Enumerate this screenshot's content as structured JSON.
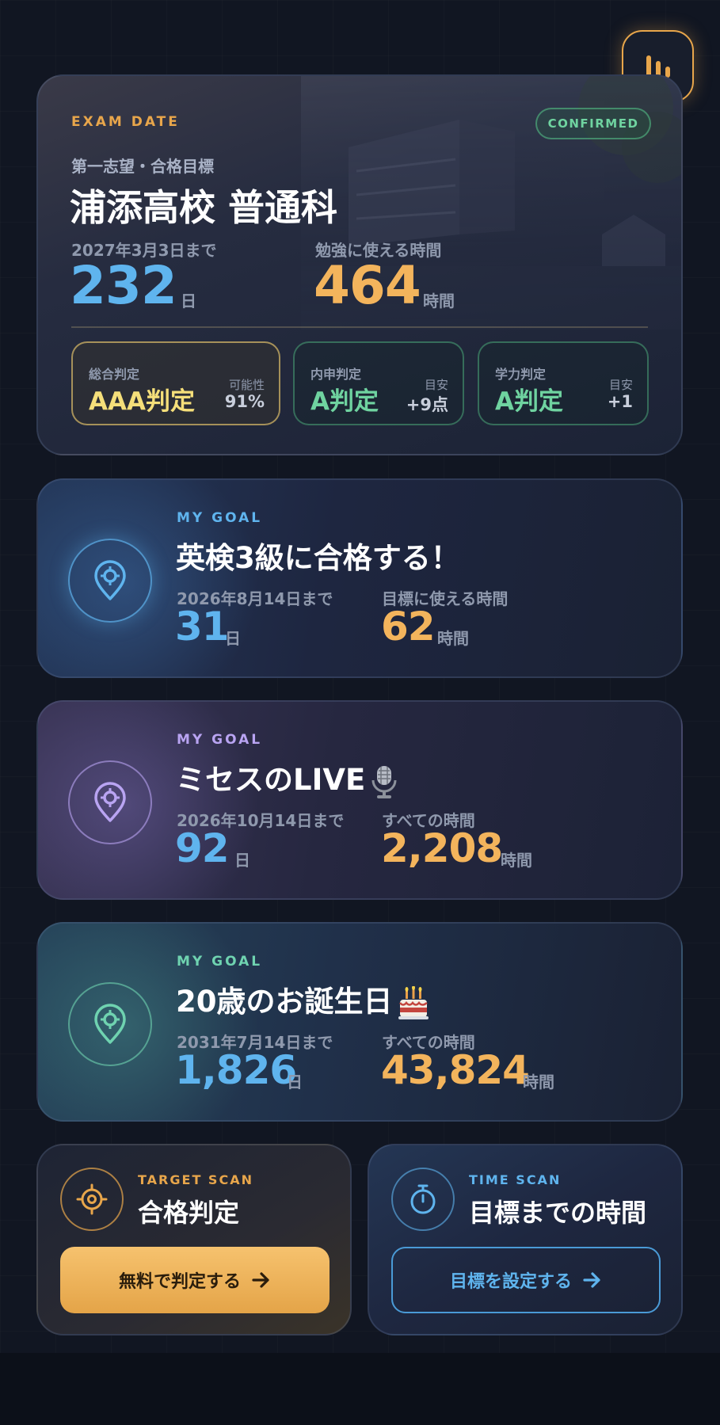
{
  "exam": {
    "label": "EXAM DATE",
    "status": "CONFIRMED",
    "sub_label": "第一志望・合格目標",
    "school": "浦添高校 普通科",
    "deadline_label": "2027年3月3日まで",
    "days": "232",
    "days_unit": "日",
    "hours_label": "勉強に使える時間",
    "hours": "464",
    "hours_unit": "時間",
    "judgements": [
      {
        "label": "総合判定",
        "value": "AAA判定",
        "sub_label": "可能性",
        "sub_value": "91%"
      },
      {
        "label": "内申判定",
        "value": "A判定",
        "sub_label": "目安",
        "sub_value": "+9点"
      },
      {
        "label": "学力判定",
        "value": "A判定",
        "sub_label": "目安",
        "sub_value": "+1"
      }
    ]
  },
  "goals": [
    {
      "caps": "MY GOAL",
      "title": "英検3級に合格する！",
      "deadline": "2026年8月14日まで",
      "days": "31",
      "days_unit": "日",
      "hours_label": "目標に使える時間",
      "hours": "62",
      "hours_unit": "時間",
      "accent": "#5fb4ee"
    },
    {
      "caps": "MY GOAL",
      "title": "ミセスのLIVE",
      "emoji": "microphone-icon",
      "deadline": "2026年10月14日まで",
      "days": "92",
      "days_unit": "日",
      "hours_label": "すべての時間",
      "hours": "2,208",
      "hours_unit": "時間",
      "accent": "#b9a4f2"
    },
    {
      "caps": "MY GOAL",
      "title": "20歳のお誕生日",
      "emoji": "birthday-cake-icon",
      "deadline": "2031年7月14日まで",
      "days": "1,826",
      "days_unit": "日",
      "hours_label": "すべての時間",
      "hours": "43,824",
      "hours_unit": "時間",
      "accent": "#6fd3b0"
    }
  ],
  "scans": [
    {
      "caps": "TARGET SCAN",
      "title": "合格判定",
      "button": "無料で判定する",
      "icon": "target-icon",
      "accent": "#e8a64b"
    },
    {
      "caps": "TIME SCAN",
      "title": "目標までの時間",
      "button": "目標を設定する",
      "icon": "stopwatch-icon",
      "accent": "#5fb4ee"
    }
  ]
}
